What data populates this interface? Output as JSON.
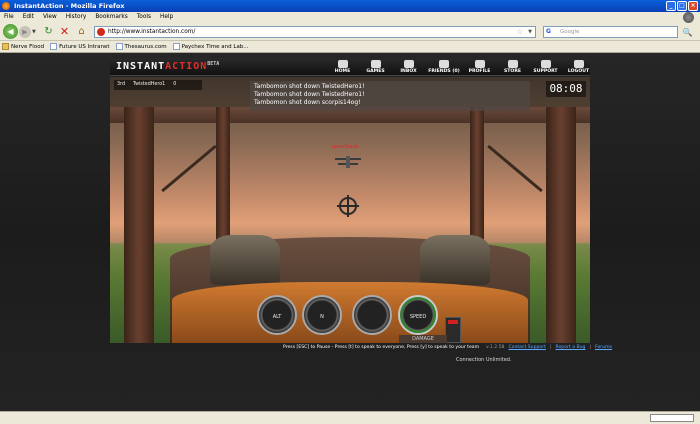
{
  "window": {
    "title": "InstantAction - Mozilla Firefox",
    "buttons": [
      "_",
      "□",
      "×"
    ]
  },
  "menu": [
    "File",
    "Edit",
    "View",
    "History",
    "Bookmarks",
    "Tools",
    "Help"
  ],
  "toolbar": {
    "back_glyph": "◀",
    "forward_glyph": "▶",
    "reload_glyph": "↻",
    "stop_glyph": "✕",
    "home_glyph": "⌂",
    "url": "http://www.instantaction.com/",
    "search_placeholder": "Google",
    "search_engine_glyph": "G",
    "search_go_glyph": "🔍"
  },
  "bookmarks": [
    {
      "label": "Nerve Flood",
      "icon": "folder-icon"
    },
    {
      "label": "Future US Intranet",
      "icon": "page-icon"
    },
    {
      "label": "Thesaurus.com",
      "icon": "page-icon"
    },
    {
      "label": "Paychex Time and Lab...",
      "icon": "page-icon"
    }
  ],
  "site": {
    "logo_left": "INSTANT",
    "logo_accent": "ACTION",
    "logo_beta": "BETA",
    "nav": [
      "HOME",
      "GAMES",
      "INBOX",
      "FRIENDS (0)",
      "PROFILE",
      "STORE",
      "SUPPORT",
      "LOGOUT"
    ]
  },
  "game": {
    "scoreboard": {
      "rank": "3rd",
      "player": "TwistedHero1",
      "score": "0"
    },
    "killfeed": [
      "Tambomon shot down TwistedHero1!",
      "Tambomon shot down TwistedHero1!",
      "Tambomon shot down scorpis14og!"
    ],
    "timer": "08:08",
    "enemy_name": "spearblade",
    "gauges": [
      "ALT",
      "N",
      "",
      "SPEED"
    ],
    "damage_label": "DAMAGE"
  },
  "footer": {
    "instructions": "Press [ESC] to Pause - Press [t] to speak to everyone, Press [y] to speak to your team",
    "version": "v.1.2.58",
    "links": [
      "Contact Support",
      "Report a Bug",
      "Forums"
    ],
    "connection": "Connection Unlimited."
  }
}
